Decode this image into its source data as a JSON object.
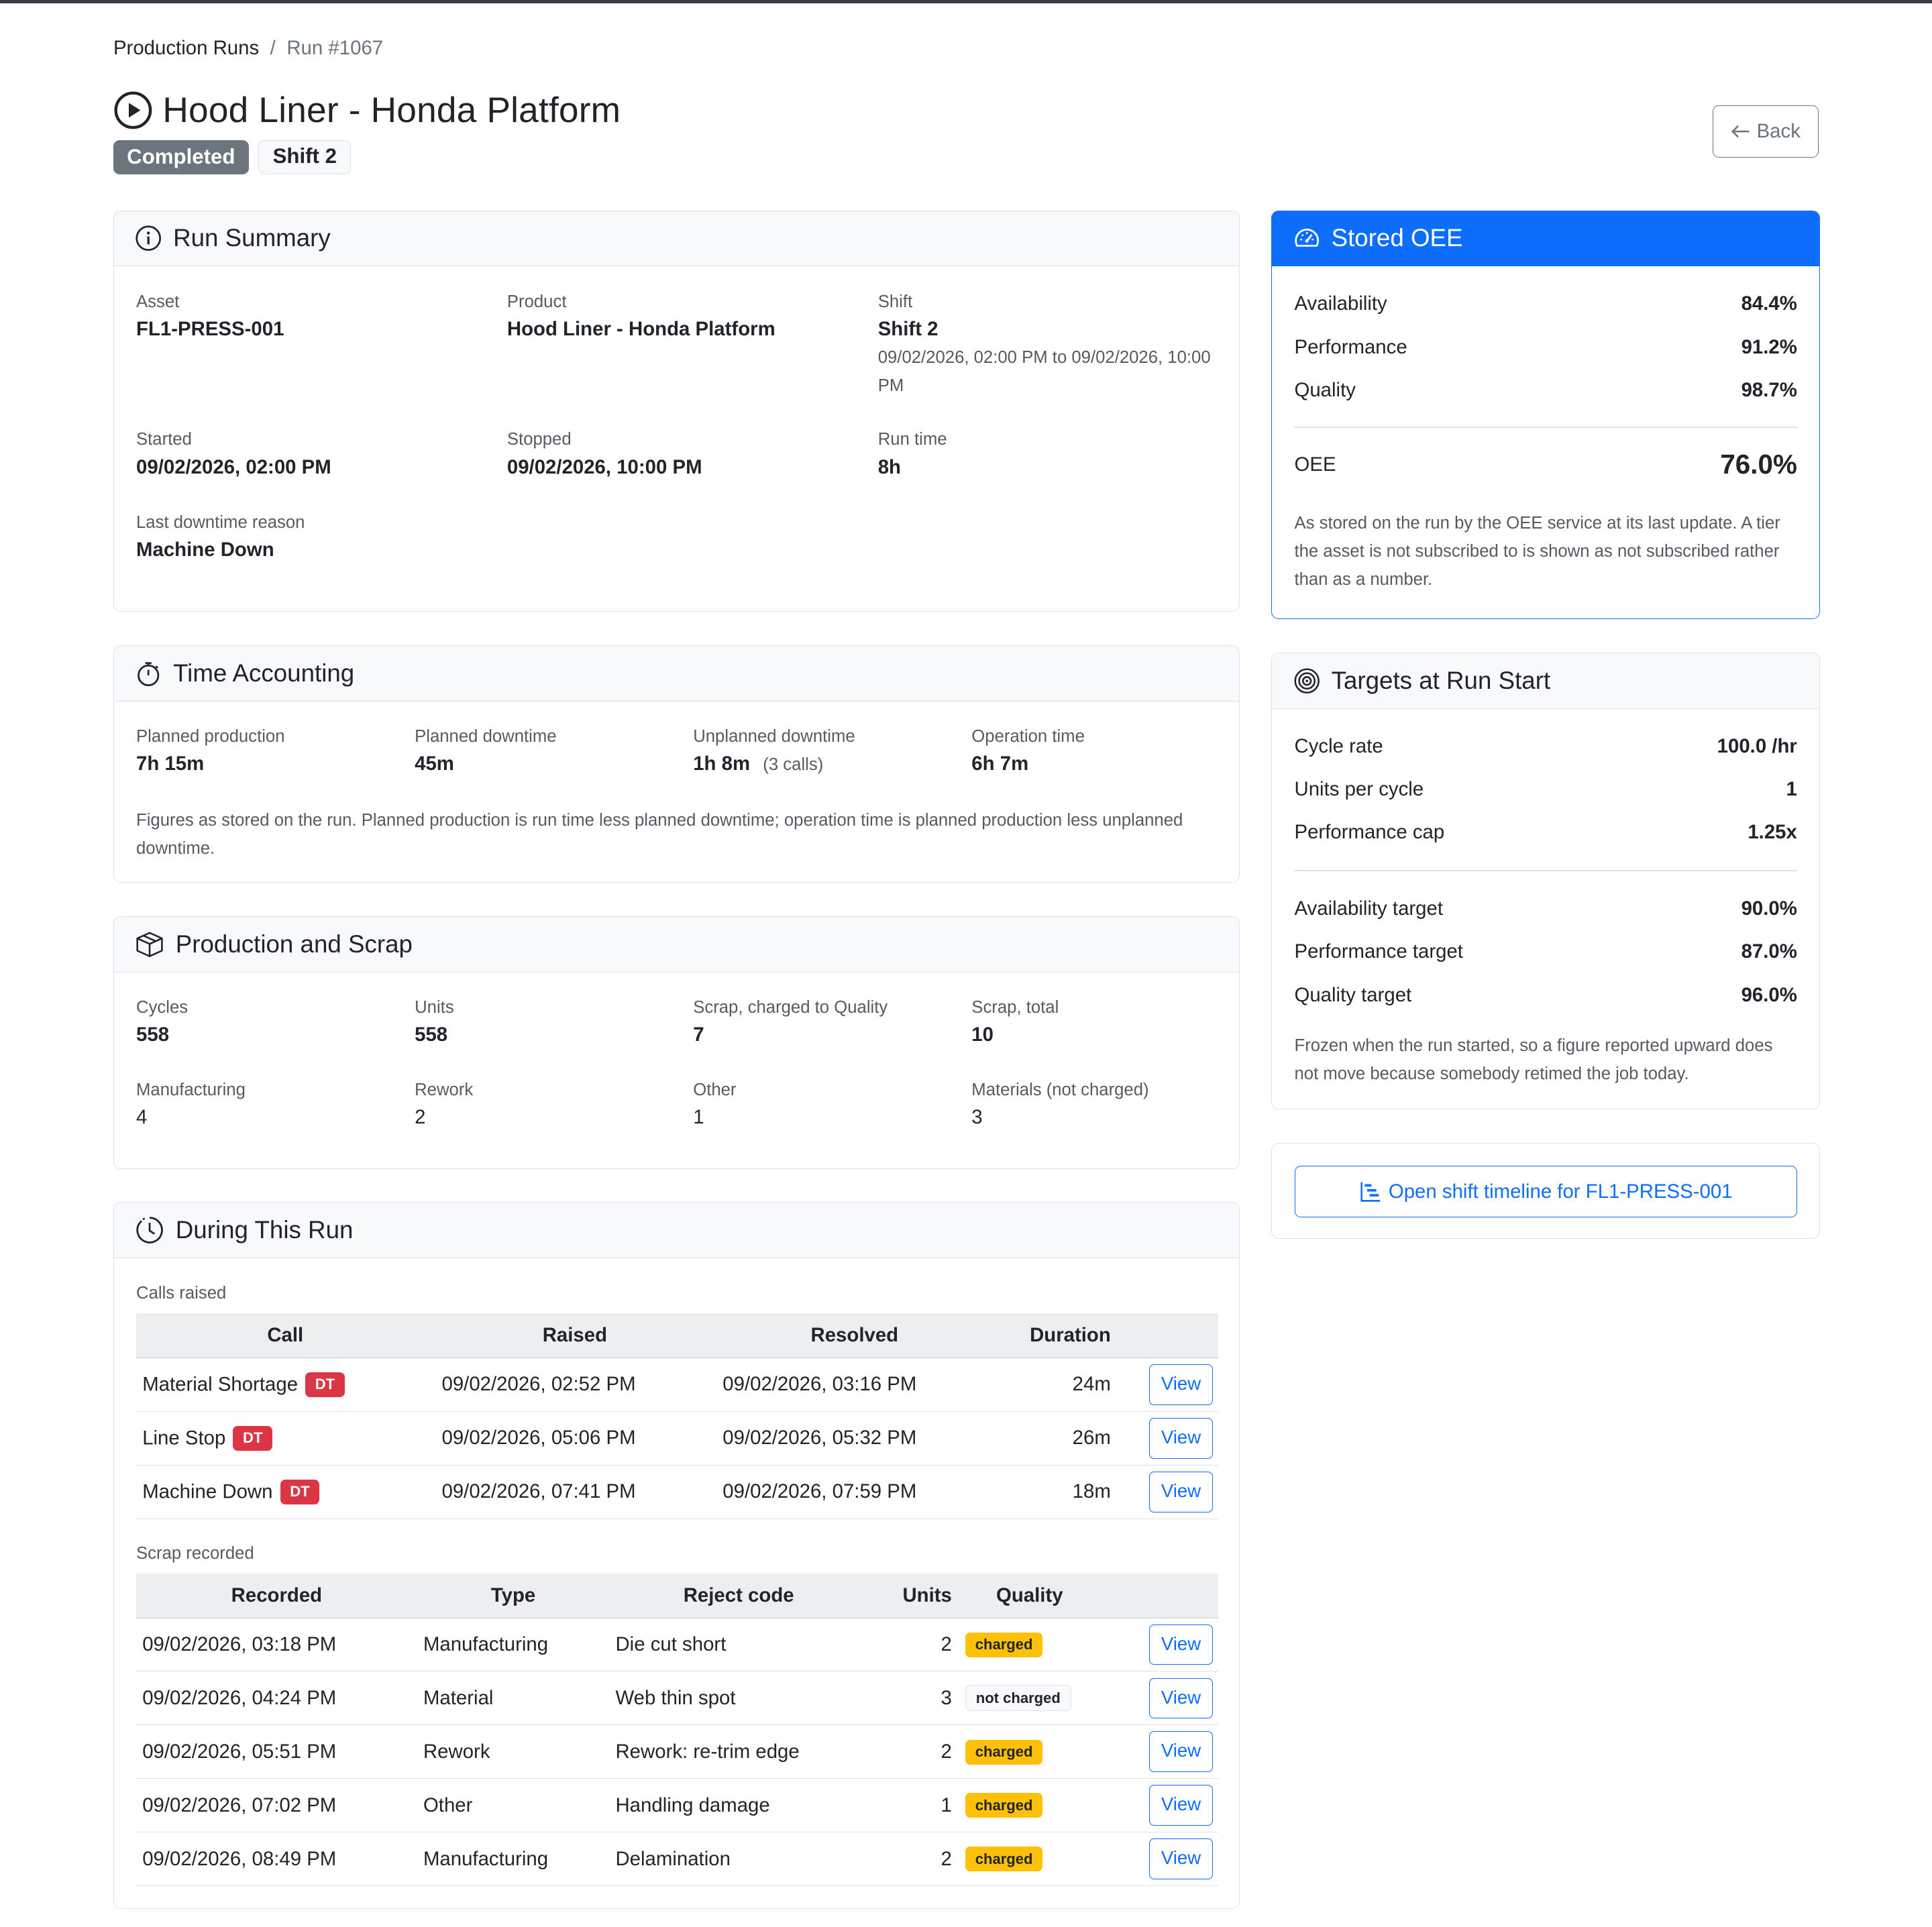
{
  "breadcrumb": {
    "parent": "Production Runs",
    "separator": "/",
    "current": "Run #1067"
  },
  "page": {
    "title": "Hood Liner - Honda Platform",
    "status": "Completed",
    "shift_badge": "Shift 2",
    "back_label": "Back"
  },
  "summary": {
    "header": "Run Summary",
    "asset_label": "Asset",
    "asset": "FL1-PRESS-001",
    "product_label": "Product",
    "product": "Hood Liner - Honda Platform",
    "shift_label": "Shift",
    "shift": "Shift 2",
    "shift_window": "09/02/2026, 02:00 PM to 09/02/2026, 10:00 PM",
    "started_label": "Started",
    "started": "09/02/2026, 02:00 PM",
    "stopped_label": "Stopped",
    "stopped": "09/02/2026, 10:00 PM",
    "runtime_label": "Run time",
    "runtime": "8h",
    "downtime_reason_label": "Last downtime reason",
    "downtime_reason": "Machine Down"
  },
  "time": {
    "header": "Time Accounting",
    "planned_production_label": "Planned production",
    "planned_production": "7h 15m",
    "planned_downtime_label": "Planned downtime",
    "planned_downtime": "45m",
    "unplanned_downtime_label": "Unplanned downtime",
    "unplanned_downtime": "1h 8m",
    "unplanned_calls": "(3 calls)",
    "operation_time_label": "Operation time",
    "operation_time": "6h 7m",
    "note": "Figures as stored on the run. Planned production is run time less planned downtime; operation time is planned production less unplanned downtime."
  },
  "production": {
    "header": "Production and Scrap",
    "cycles_label": "Cycles",
    "cycles": "558",
    "units_label": "Units",
    "units": "558",
    "scrap_quality_label": "Scrap, charged to Quality",
    "scrap_quality": "7",
    "scrap_total_label": "Scrap, total",
    "scrap_total": "10",
    "manufacturing_label": "Manufacturing",
    "manufacturing": "4",
    "rework_label": "Rework",
    "rework": "2",
    "other_label": "Other",
    "other": "1",
    "materials_label": "Materials (not charged)",
    "materials": "3"
  },
  "during": {
    "header": "During This Run",
    "calls_label": "Calls raised",
    "calls_columns": [
      "Call",
      "Raised",
      "Resolved",
      "Duration"
    ],
    "calls": [
      {
        "call": "Material Shortage",
        "tag": "DT",
        "raised": "09/02/2026, 02:52 PM",
        "resolved": "09/02/2026, 03:16 PM",
        "duration": "24m",
        "action": "View"
      },
      {
        "call": "Line Stop",
        "tag": "DT",
        "raised": "09/02/2026, 05:06 PM",
        "resolved": "09/02/2026, 05:32 PM",
        "duration": "26m",
        "action": "View"
      },
      {
        "call": "Machine Down",
        "tag": "DT",
        "raised": "09/02/2026, 07:41 PM",
        "resolved": "09/02/2026, 07:59 PM",
        "duration": "18m",
        "action": "View"
      }
    ],
    "scrap_label": "Scrap recorded",
    "scrap_columns": [
      "Recorded",
      "Type",
      "Reject code",
      "Units",
      "Quality"
    ],
    "scrap": [
      {
        "recorded": "09/02/2026, 03:18 PM",
        "type": "Manufacturing",
        "code": "Die cut short",
        "units": "2",
        "quality": "charged",
        "charged": true,
        "action": "View"
      },
      {
        "recorded": "09/02/2026, 04:24 PM",
        "type": "Material",
        "code": "Web thin spot",
        "units": "3",
        "quality": "not charged",
        "charged": false,
        "action": "View"
      },
      {
        "recorded": "09/02/2026, 05:51 PM",
        "type": "Rework",
        "code": "Rework: re-trim edge",
        "units": "2",
        "quality": "charged",
        "charged": true,
        "action": "View"
      },
      {
        "recorded": "09/02/2026, 07:02 PM",
        "type": "Other",
        "code": "Handling damage",
        "units": "1",
        "quality": "charged",
        "charged": true,
        "action": "View"
      },
      {
        "recorded": "09/02/2026, 08:49 PM",
        "type": "Manufacturing",
        "code": "Delamination",
        "units": "2",
        "quality": "charged",
        "charged": true,
        "action": "View"
      }
    ]
  },
  "oee": {
    "header": "Stored OEE",
    "availability_label": "Availability",
    "availability": "84.4%",
    "performance_label": "Performance",
    "performance": "91.2%",
    "quality_label": "Quality",
    "quality": "98.7%",
    "oee_label": "OEE",
    "oee": "76.0%",
    "note": "As stored on the run by the OEE service at its last update. A tier the asset is not subscribed to is shown as not subscribed rather than as a number."
  },
  "targets": {
    "header": "Targets at Run Start",
    "cycle_rate_label": "Cycle rate",
    "cycle_rate": "100.0 /hr",
    "units_per_cycle_label": "Units per cycle",
    "units_per_cycle": "1",
    "perf_cap_label": "Performance cap",
    "perf_cap": "1.25x",
    "avail_target_label": "Availability target",
    "avail_target": "90.0%",
    "perf_target_label": "Performance target",
    "perf_target": "87.0%",
    "quality_target_label": "Quality target",
    "quality_target": "96.0%",
    "note": "Frozen when the run started, so a figure reported upward does not move because somebody retimed the job today."
  },
  "timeline": {
    "label": "Open shift timeline for FL1-PRESS-001"
  },
  "colors": {
    "primary": "#0d6efd",
    "danger": "#dc3545",
    "warning": "#ffc107",
    "secondary": "#6c757d"
  }
}
